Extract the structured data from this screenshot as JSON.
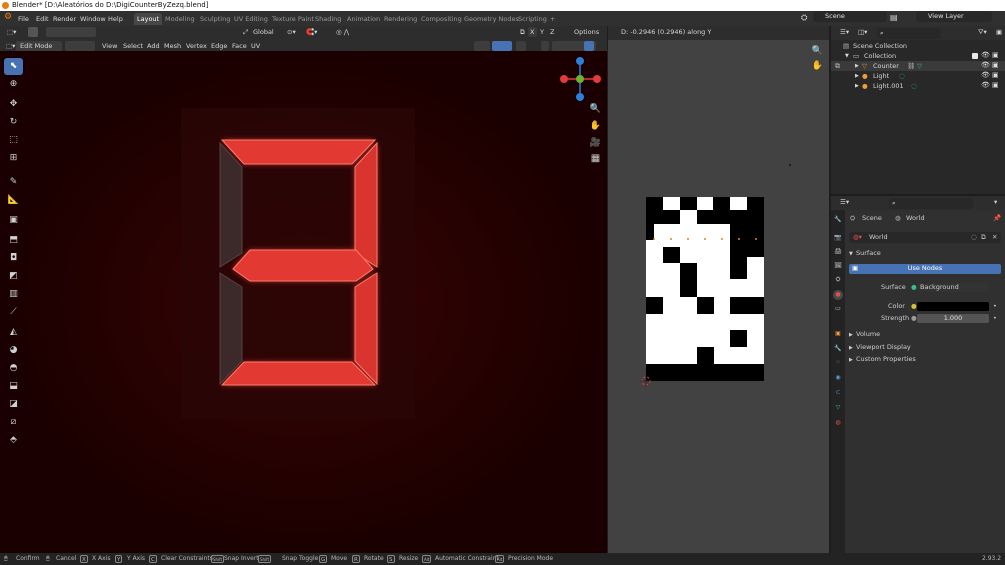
{
  "window": {
    "title": "Blender* [D:\\Aleatórios do D:\\DigiCounterByZezq.blend]"
  },
  "menu": [
    "File",
    "Edit",
    "Render",
    "Window",
    "Help"
  ],
  "workspaces": [
    "Layout",
    "Modeling",
    "Sculpting",
    "UV Editing",
    "Texture Paint",
    "Shading",
    "Animation",
    "Rendering",
    "Compositing",
    "Geometry Nodes",
    "Scripting",
    "+"
  ],
  "scene": {
    "name": "Scene",
    "view_layer": "View Layer"
  },
  "viewport": {
    "mode": "Edit Mode",
    "menus": [
      "View",
      "Select",
      "Add",
      "Mesh",
      "Vertex",
      "Edge",
      "Face",
      "UV"
    ],
    "orientation": "Global",
    "options": "Options",
    "axes": [
      "X",
      "Y",
      "Z"
    ]
  },
  "uv_editor": {
    "header_text": "D: -0.2946 (0.2946) along Y"
  },
  "outliner": {
    "items": [
      {
        "label": "Scene Collection",
        "icon": "scene-collection-icon"
      },
      {
        "label": "Collection",
        "icon": "collection-icon"
      },
      {
        "label": "Counter",
        "icon": "mesh-icon"
      },
      {
        "label": "Light",
        "icon": "light-icon"
      },
      {
        "label": "Light.001",
        "icon": "light-icon"
      }
    ]
  },
  "properties": {
    "breadcrumb": [
      "Scene",
      "World"
    ],
    "world_name": "World",
    "panel_surface": "Surface",
    "use_nodes": "Use Nodes",
    "surface_label": "Surface",
    "surface_value": "Background",
    "color_label": "Color",
    "color_value": "#000000",
    "strength_label": "Strength",
    "strength_value": "1.000",
    "collapsed_panels": [
      "Volume",
      "Viewport Display",
      "Custom Properties"
    ]
  },
  "statusbar": {
    "items": [
      {
        "key": "",
        "label": "Confirm"
      },
      {
        "key": "",
        "label": "Cancel"
      },
      {
        "key": "X",
        "label": "X Axis"
      },
      {
        "key": "Y",
        "label": "Y Axis"
      },
      {
        "key": "C",
        "label": "Clear Constraints"
      },
      {
        "key": "Shift",
        "label": "Snap Invert"
      },
      {
        "key": "Shift",
        "label": "Snap Toggle"
      },
      {
        "key": "G",
        "label": "Move"
      },
      {
        "key": "R",
        "label": "Rotate"
      },
      {
        "key": "S",
        "label": "Resize"
      },
      {
        "key": "Alt",
        "label": "Automatic Constraint"
      },
      {
        "key": "Alt",
        "label": "Precision Mode"
      }
    ],
    "version": "2.93.2"
  },
  "colors": {
    "accent": "#4772b3",
    "segment": "#e23a33",
    "gizmo_x": "#e03c3c",
    "gizmo_y": "#6ab42e",
    "gizmo_z": "#2d7fd8"
  }
}
